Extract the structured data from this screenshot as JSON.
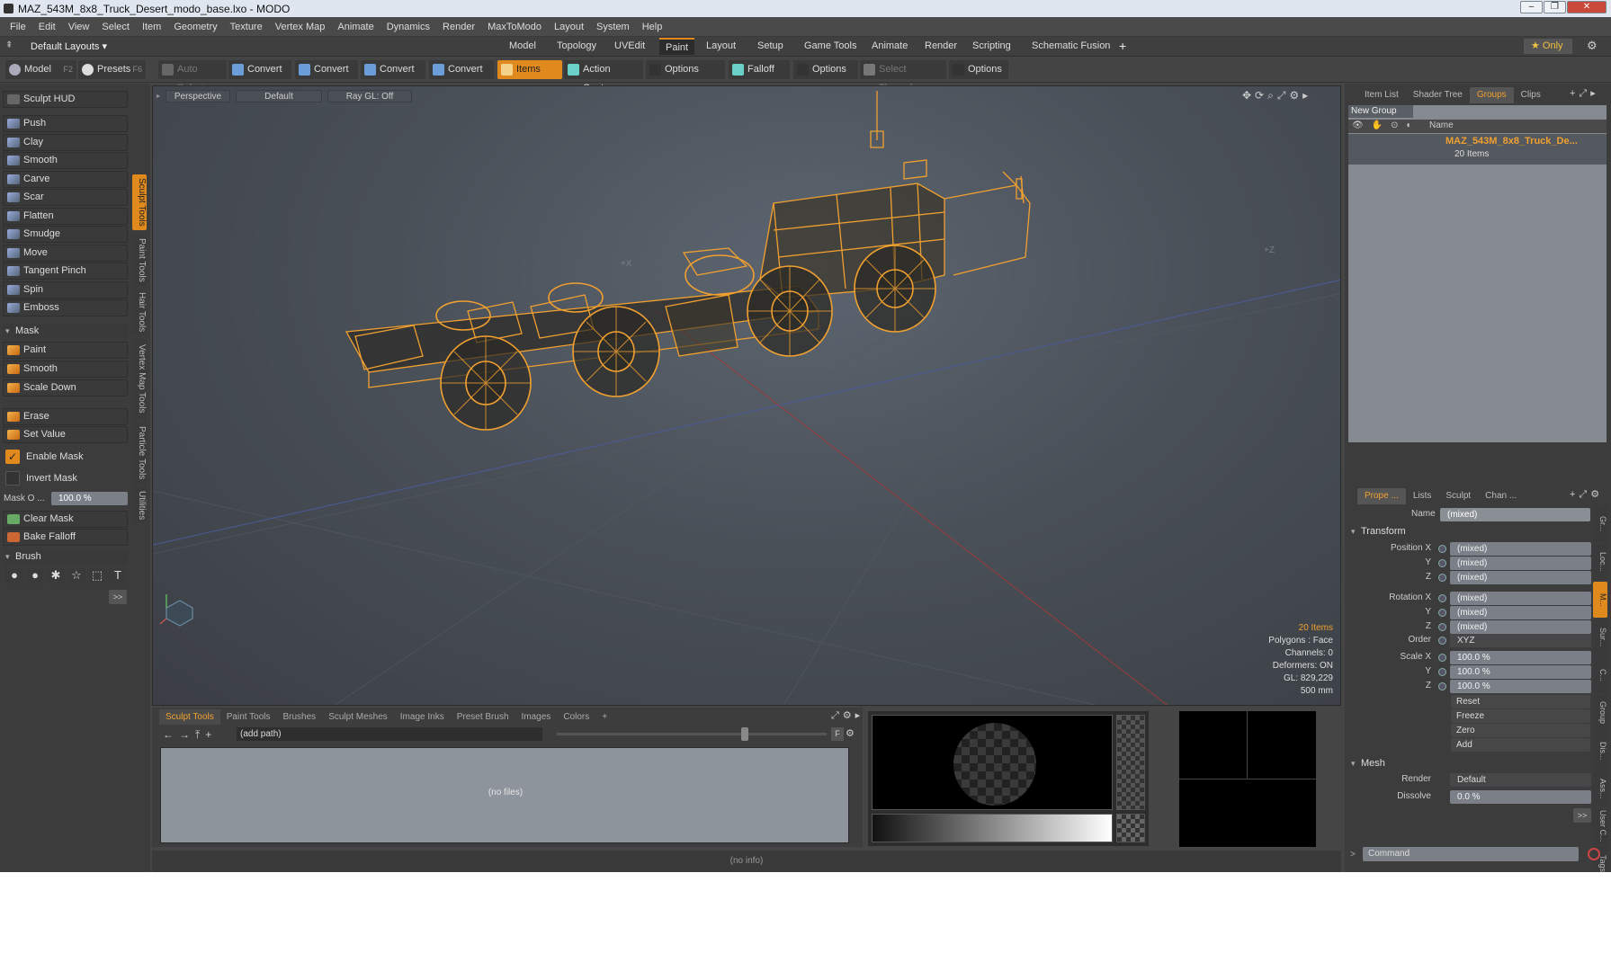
{
  "window": {
    "title": "MAZ_543M_8x8_Truck_Desert_modo_base.lxo - MODO",
    "controls": [
      "–",
      "❐",
      "✕"
    ]
  },
  "menubar": [
    "File",
    "Edit",
    "View",
    "Select",
    "Item",
    "Geometry",
    "Texture",
    "Vertex Map",
    "Animate",
    "Dynamics",
    "Render",
    "MaxToModo",
    "Layout",
    "System",
    "Help"
  ],
  "layoutbar": {
    "layout_select": "Default Layouts ▾",
    "tabs": [
      "Model",
      "Topology",
      "UVEdit",
      "Paint",
      "Layout",
      "Setup",
      "Game Tools",
      "Animate",
      "Render",
      "Scripting",
      "Schematic Fusion"
    ],
    "active_tab": "Paint",
    "add": "+",
    "only_label": "★ Only"
  },
  "toolrow": {
    "model": "Model",
    "model_key": "F2",
    "presets": "Presets",
    "presets_key": "F6",
    "buttons": [
      "Auto Select",
      "Convert",
      "Convert",
      "Convert",
      "Convert",
      "Items",
      "Action Center",
      "Options",
      "Falloff",
      "Options",
      "Select Through",
      "Options"
    ]
  },
  "leftpanel": {
    "hud": "Sculpt HUD",
    "tools": [
      "Push",
      "Clay",
      "Smooth",
      "Carve",
      "Scar",
      "Flatten",
      "Smudge",
      "Move",
      "Tangent Pinch",
      "Spin",
      "Emboss"
    ],
    "mask_section": "Mask",
    "mask_tools": [
      "Paint",
      "Smooth",
      "Scale Down"
    ],
    "erase": "Erase",
    "set_value": "Set Value",
    "enable_mask": "Enable Mask",
    "invert_mask": "Invert Mask",
    "mask_opacity_label": "Mask O ...",
    "mask_opacity_value": "100.0 %",
    "clear_mask": "Clear Mask",
    "bake_falloff": "Bake Falloff",
    "brush_section": "Brush",
    "brush_icons": [
      "●",
      "●",
      "✱",
      "☆",
      "⬚",
      "T"
    ],
    "more": ">>"
  },
  "vtabs": [
    "Sculpt Tools",
    "Paint Tools",
    "Hair Tools",
    "Vertex Map Tools",
    "Particle Tools",
    "Utilities"
  ],
  "viewport": {
    "view": "Perspective",
    "shading": "Default",
    "raygl": "Ray GL: Off",
    "axis_labels": {
      "x": "+X",
      "z": "+Z"
    },
    "info": {
      "items": "20 Items",
      "polygons": "Polygons : Face",
      "channels": "Channels: 0",
      "deformers": "Deformers: ON",
      "gl": "GL: 829,229",
      "scale": "500 mm"
    },
    "wire_color": "#f0a030"
  },
  "bottompanel": {
    "tabs": [
      "Sculpt Tools",
      "Paint Tools",
      "Brushes",
      "Sculpt Meshes",
      "Image Inks",
      "Preset Brush",
      "Images",
      "Colors",
      "+"
    ],
    "path": "(add path)",
    "no_files": "(no files)",
    "f_label": "F"
  },
  "statusbar": {
    "text": "(no info)"
  },
  "rightpanel": {
    "top_tabs": [
      "Item List",
      "Shader Tree",
      "Groups",
      "Clips"
    ],
    "active_top_tab": "Groups",
    "new_group": "New Group",
    "name_header": "Name",
    "group_name": "MAZ_543M_8x8_Truck_De...",
    "group_count": "20 Items",
    "prop_tabs": [
      "Prope ...",
      "Lists",
      "Sculpt",
      "Chan ..."
    ],
    "name_label": "Name",
    "name_value": "(mixed)",
    "transform_section": "Transform",
    "position": {
      "label": "Position X",
      "values": [
        "(mixed)",
        "(mixed)",
        "(mixed)"
      ]
    },
    "rotation": {
      "label": "Rotation X",
      "values": [
        "(mixed)",
        "(mixed)",
        "(mixed)"
      ]
    },
    "order": {
      "label": "Order",
      "value": "XYZ"
    },
    "scale": {
      "label": "Scale X",
      "values": [
        "100.0 %",
        "100.0 %",
        "100.0 %"
      ]
    },
    "axis_y": "Y",
    "axis_z": "Z",
    "actions": [
      "Reset",
      "Freeze",
      "Zero",
      "Add"
    ],
    "mesh_section": "Mesh",
    "render": {
      "label": "Render",
      "value": "Default"
    },
    "dissolve": {
      "label": "Dissolve",
      "value": "0.0 %"
    },
    "side_tabs": [
      "Gr...",
      "Loc...",
      "M...",
      "Sur...",
      "C...",
      "Group",
      "Dis...",
      "Ass...",
      "User C...",
      "Tags"
    ],
    "command_placeholder": "Command",
    "more": ">>"
  }
}
